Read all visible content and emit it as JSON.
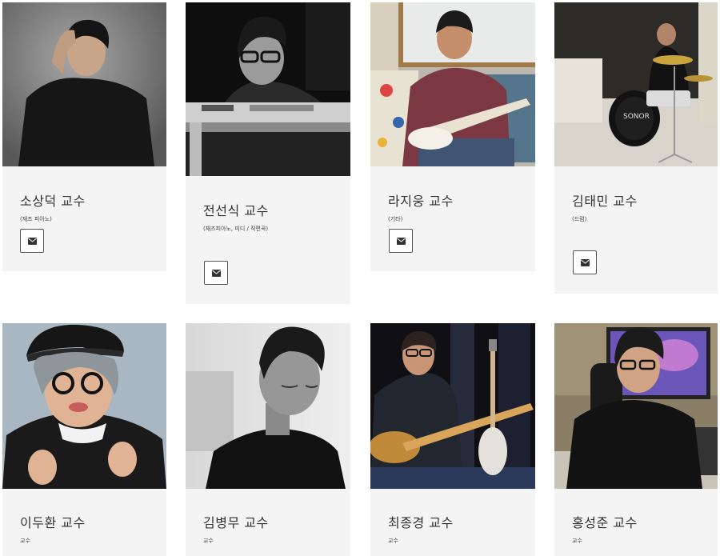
{
  "faculty": [
    {
      "name": "소상덕 교수",
      "role": "(재즈 피아노)",
      "icon": "envelope-icon"
    },
    {
      "name": "전선식 교수",
      "role": "(재즈피아노, 미디 / 작편곡)",
      "icon": "envelope-icon"
    },
    {
      "name": "라지웅 교수",
      "role": "(기타)",
      "icon": "envelope-icon"
    },
    {
      "name": "김태민 교수",
      "role": "(드럼)",
      "icon": "envelope-icon"
    },
    {
      "name": "이두환 교수",
      "role": "교수"
    },
    {
      "name": "김병무 교수",
      "role": "교수"
    },
    {
      "name": "최종경 교수",
      "role": "교수"
    },
    {
      "name": "홍성준 교수",
      "role": "교수"
    }
  ]
}
